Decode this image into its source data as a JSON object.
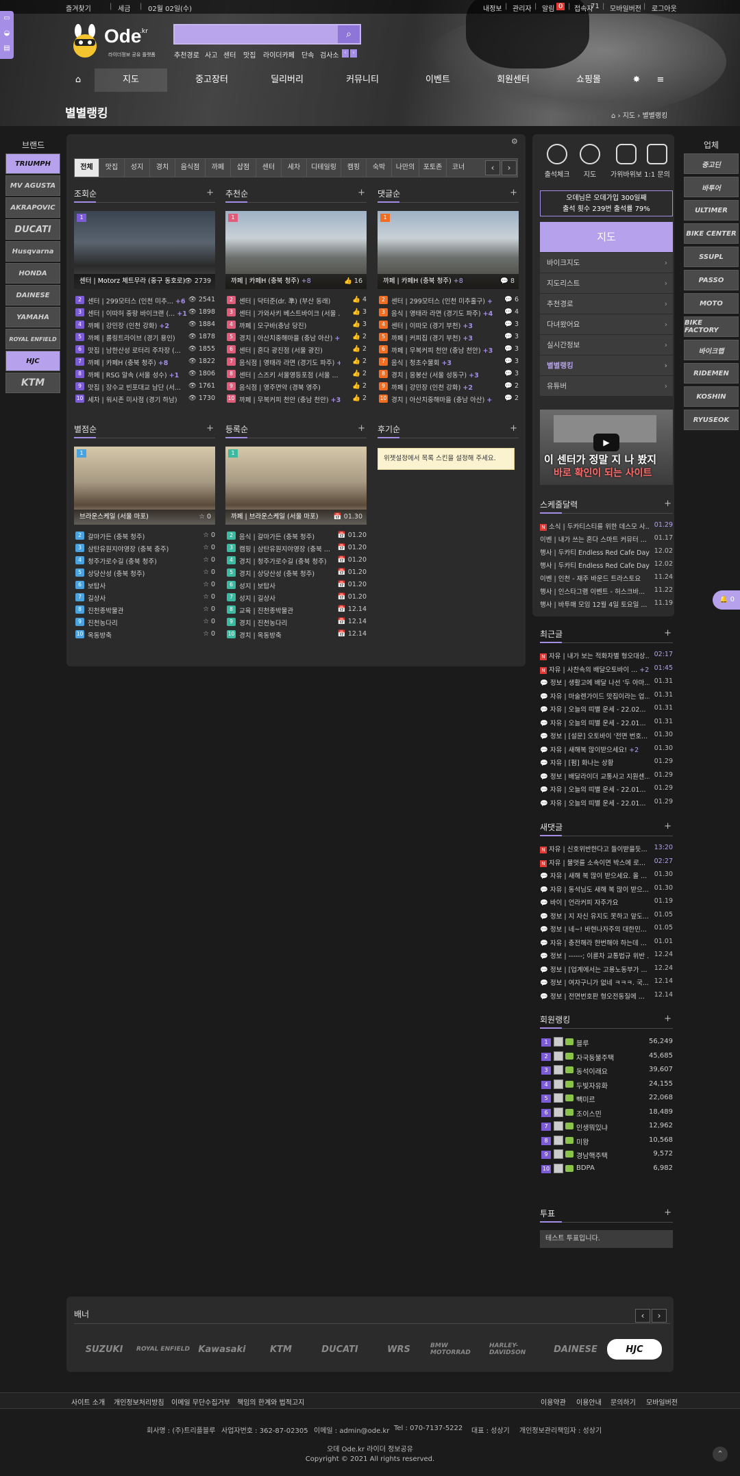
{
  "topbar": {
    "left": [
      "즐겨찾기",
      "세금",
      "02월 02일(수)"
    ],
    "right": [
      "내정보",
      "관리자",
      "알림",
      "접속자",
      "모바일버전",
      "로그아웃"
    ],
    "alarm_count": "0",
    "visitor_count": "71"
  },
  "logo": {
    "text": "Ode",
    "sup": ".kr",
    "tagline": "라이더정보 공유 플랫폼"
  },
  "search": {
    "placeholder": ""
  },
  "keywords": [
    "추천경로",
    "사고",
    "센터",
    "맛집",
    "라이더카페",
    "단속",
    "검사소"
  ],
  "nav": [
    "지도",
    "중고장터",
    "딜리버리",
    "커뮤니티",
    "이벤트",
    "회원센터",
    "쇼핑몰"
  ],
  "page_title": "별별랭킹",
  "breadcrumb": [
    "지도",
    "별별랭킹"
  ],
  "brand_left": {
    "title": "브랜드",
    "items": [
      "TRIUMPH",
      "MV AGUSTA",
      "AKRAPOVIC",
      "DUCATI",
      "Husqvarna",
      "HONDA",
      "DAINESE",
      "YAMAHA",
      "ROYAL ENFIELD",
      "HJC",
      "KTM"
    ]
  },
  "brand_right": {
    "title": "업체",
    "items": [
      "중고딘",
      "바투어",
      "ULTIMER",
      "BIKE CENTER",
      "SSUPL",
      "PASSO",
      "MOTO",
      "BIKE FACTORY",
      "바이크랩",
      "RIDEMEN",
      "KOSHIN",
      "RYUSEOK"
    ]
  },
  "tabs": {
    "items": [
      "전체",
      "맛집",
      "성지",
      "경치",
      "음식점",
      "까페",
      "샵점",
      "센터",
      "세차",
      "디테일링",
      "캠핑",
      "숙박",
      "나만의",
      "포토존",
      "코너"
    ],
    "prev": "‹",
    "next": "›"
  },
  "sections": [
    {
      "title": "조회순",
      "feature": {
        "rank": "1",
        "caption": "센터 | Motorz 체트무라 (중구 동호로)",
        "count": "2739",
        "count_icon": "👁"
      },
      "rows": [
        {
          "n": "2",
          "title": "센터 | 299모터스 (인천 미추...",
          "c": "+6",
          "v": "2541"
        },
        {
          "n": "3",
          "title": "센터 | 이따허 중랑 바이크랜 (...",
          "c": "+1",
          "v": "1898"
        },
        {
          "n": "4",
          "title": "까페 | 강민장 (인천 강화)",
          "c": "+2",
          "v": "1884"
        },
        {
          "n": "5",
          "title": "까페 | 롤링트라이브 (경기 용인)",
          "c": "",
          "v": "1878"
        },
        {
          "n": "6",
          "title": "맛집 | 남한산성 로터리 주차장 (...",
          "c": "",
          "v": "1855"
        },
        {
          "n": "7",
          "title": "까페 | 카페H (충북 청주)",
          "c": "+8",
          "v": "1822"
        },
        {
          "n": "8",
          "title": "까페 | RSG 알속 (서울 성수)",
          "c": "+1",
          "v": "1806"
        },
        {
          "n": "9",
          "title": "맛집 | 장수교 빈포대교 남단 (서...",
          "c": "",
          "v": "1761"
        },
        {
          "n": "10",
          "title": "세차 | 워시존 미사점 (경기 하남)",
          "c": "",
          "v": "1730"
        }
      ]
    },
    {
      "title": "추천순",
      "feature": {
        "rank": "1",
        "caption": "까페 | 카페H (충북 청주)",
        "c": "+8",
        "count": "16",
        "count_icon": "👍"
      },
      "rows": [
        {
          "n": "2",
          "title": "센터 | 닥터준(dr. 準) (부산 동래)",
          "c": "",
          "v": "4"
        },
        {
          "n": "3",
          "title": "센터 | 가와사키 베스트바이크 (서울 ...",
          "c": "",
          "v": "3"
        },
        {
          "n": "4",
          "title": "까페 | 모구바(충남 당진)",
          "c": "",
          "v": "3"
        },
        {
          "n": "5",
          "title": "경치 | 아산치중해마을 (충남 아산)",
          "c": "+2",
          "v": "2"
        },
        {
          "n": "6",
          "title": "센터 | 혼다 광진점 (서울 광진)",
          "c": "",
          "v": "2"
        },
        {
          "n": "7",
          "title": "음식점 | 영태라 라면 (경기도 파주)",
          "c": "+4",
          "v": "2"
        },
        {
          "n": "8",
          "title": "센터 | 스즈키 서울영등포점 (서울 ...",
          "c": "+2",
          "v": "2"
        },
        {
          "n": "9",
          "title": "음식점 | 영주면악 (경북 영주)",
          "c": "",
          "v": "2"
        },
        {
          "n": "10",
          "title": "까페 | 무복커피 천안 (충남 천안)",
          "c": "+3",
          "v": "2"
        }
      ]
    },
    {
      "title": "댓글순",
      "feature": {
        "rank": "1",
        "caption": "까페 | 카페H (충북 청주)",
        "c": "+8",
        "count": "8",
        "count_icon": "💬"
      },
      "rows": [
        {
          "n": "2",
          "title": "센터 | 299모터스 (인천 미추홀구)",
          "c": "+6",
          "v": "6"
        },
        {
          "n": "3",
          "title": "음식 | 영태라 라면 (경기도 파주)",
          "c": "+4",
          "v": "4"
        },
        {
          "n": "4",
          "title": "센터 | 이따모 (경기 부천)",
          "c": "+3",
          "v": "3"
        },
        {
          "n": "5",
          "title": "까페 | 커피집 (경기 부천)",
          "c": "+3",
          "v": "3"
        },
        {
          "n": "6",
          "title": "까페 | 무복커피 천안 (충남 천안)",
          "c": "+3",
          "v": "3"
        },
        {
          "n": "7",
          "title": "음식 | 청초수물회",
          "c": "+3",
          "v": "3"
        },
        {
          "n": "8",
          "title": "경치 | 응봉산 (서울 성동구)",
          "c": "+3",
          "v": "3"
        },
        {
          "n": "9",
          "title": "까페 | 강민장 (인천 강화)",
          "c": "+2",
          "v": "2"
        },
        {
          "n": "10",
          "title": "경치 | 아산치중해마을 (충남 아산)",
          "c": "+2",
          "v": "2"
        }
      ]
    },
    {
      "title": "별점순",
      "feature": {
        "rank": "1",
        "caption": "브라운스케일 (서울 마포)",
        "count": "0",
        "count_icon": "☆"
      },
      "rows": [
        {
          "n": "2",
          "title": "갈마가든 (충북 청주)",
          "c": "",
          "v": "0"
        },
        {
          "n": "3",
          "title": "삼탄유원지야영장 (충북 충주)",
          "c": "",
          "v": "0"
        },
        {
          "n": "4",
          "title": "청주가로수길 (충북 청주)",
          "c": "",
          "v": "0"
        },
        {
          "n": "5",
          "title": "상당산성 (충북 청주)",
          "c": "",
          "v": "0"
        },
        {
          "n": "6",
          "title": "보탑사",
          "c": "",
          "v": "0"
        },
        {
          "n": "7",
          "title": "길상사",
          "c": "",
          "v": "0"
        },
        {
          "n": "8",
          "title": "진천종박물관",
          "c": "",
          "v": "0"
        },
        {
          "n": "9",
          "title": "진천농다리",
          "c": "",
          "v": "0"
        },
        {
          "n": "10",
          "title": "옥동방축",
          "c": "",
          "v": "0"
        }
      ]
    },
    {
      "title": "등록순",
      "feature": {
        "rank": "1",
        "caption": "까페 | 브라운스케일 (서울 마포)",
        "count": "01.30",
        "count_icon": "📅"
      },
      "rows": [
        {
          "n": "2",
          "title": "음식 | 갈마가든 (충북 청주)",
          "c": "",
          "v": "01.20"
        },
        {
          "n": "3",
          "title": "캠핑 | 삼탄유원지야영장 (충북 ...",
          "c": "",
          "v": "01.20"
        },
        {
          "n": "4",
          "title": "경치 | 청주가로수길 (충북 청주)",
          "c": "",
          "v": "01.20"
        },
        {
          "n": "5",
          "title": "경치 | 상당산성 (충북 청주)",
          "c": "",
          "v": "01.20"
        },
        {
          "n": "6",
          "title": "성지 | 보탑사",
          "c": "",
          "v": "01.20"
        },
        {
          "n": "7",
          "title": "성지 | 길상사",
          "c": "",
          "v": "01.20"
        },
        {
          "n": "8",
          "title": "교육 | 진천종박물관",
          "c": "",
          "v": "12.14"
        },
        {
          "n": "9",
          "title": "경치 | 진천농다리",
          "c": "",
          "v": "12.14"
        },
        {
          "n": "10",
          "title": "경치 | 옥동방축",
          "c": "",
          "v": "12.14"
        }
      ]
    },
    {
      "title": "후기순",
      "notice": "위젯설정에서 목록 스킨을 설정해 주세요."
    }
  ],
  "quick": [
    "출석체크",
    "지도",
    "가위바위보",
    "1:1 문의"
  ],
  "attendance": {
    "line1": "오데님은 오데가입 300일째",
    "line2": "출석 횟수 239번 출석률 79%"
  },
  "right_menu": {
    "title": "지도",
    "items": [
      "바이크지도",
      "지도리스트",
      "추천경로",
      "다녀왔어요",
      "실시간정보",
      "별별랭킹",
      "유튜버"
    ]
  },
  "video": {
    "line1": "이 센터가 정말 지 나 봤지",
    "line2": "바로 확인이 되는 사이트"
  },
  "schedule": {
    "title": "스케줄달력",
    "items": [
      {
        "t": "소식 | 두카티스티를 위한 데스모 사...",
        "d": "01.29",
        "new": true
      },
      {
        "t": "이벤 | 내가 쓰는 혼다 스마트 커뮤터 ...",
        "d": "01.17"
      },
      {
        "t": "행사 | 두카티 Endless Red Cafe Day",
        "d": "12.02"
      },
      {
        "t": "행사 | 두카티 Endless Red Cafe Day",
        "d": "12.02"
      },
      {
        "t": "이벤 | 인천 - 재주 바운드 트라스토요",
        "d": "11.24"
      },
      {
        "t": "행사 | 인스타그램 이벤트 - 허스크바...",
        "d": "11.22"
      },
      {
        "t": "행사 | 바투매 모임 12월 4일 토요일 ...",
        "d": "11.19"
      }
    ]
  },
  "recent_posts": {
    "title": "최근글",
    "items": [
      {
        "t": "자유 | 내가 보는 적화차별 형오대상...",
        "d": "02:17",
        "new": true
      },
      {
        "t": "자유 | 사찬속의 배달오토바이 ...",
        "c": "+2",
        "d": "01:45",
        "new": true
      },
      {
        "t": "정보 | 생활고에 배달 나선 '두 아마...",
        "d": "01.31"
      },
      {
        "t": "자유 | 마술렌가이드 맛집이라는 업...",
        "d": "01.31"
      },
      {
        "t": "자유 | 오늘의 띠별 운세 - 22.02...",
        "d": "01.31"
      },
      {
        "t": "자유 | 오늘의 띠별 운세 - 22.01...",
        "d": "01.31"
      },
      {
        "t": "정보 | [설문] 오토바이 '전면 번호...",
        "d": "01.30"
      },
      {
        "t": "자유 | 새해복 많이받으세요!",
        "c": "+2",
        "d": "01.30"
      },
      {
        "t": "자유 | [펌] 화나는 상황",
        "d": "01.29"
      },
      {
        "t": "정보 | 배달라이더 교통사고 지원센...",
        "d": "01.29"
      },
      {
        "t": "자유 | 오늘의 띠별 운세 - 22.01...",
        "d": "01.29"
      },
      {
        "t": "자유 | 오늘의 띠별 운세 - 22.01...",
        "d": "01.29"
      }
    ]
  },
  "recent_comments": {
    "title": "새댓글",
    "items": [
      {
        "t": "자유 | 신호위반한다고 들이받을듯...",
        "d": "13:20",
        "new": true
      },
      {
        "t": "자유 | 물멋를 소속이면 박스에 로...",
        "d": "02:27",
        "new": true
      },
      {
        "t": "자유 | 새해 복 많이 받으세요. 올 ...",
        "d": "01.30"
      },
      {
        "t": "자유 | 동석님도 새해 복 많이 받으...",
        "d": "01.30"
      },
      {
        "t": "바이 | 언라커피 자주가요",
        "d": "01.19"
      },
      {
        "t": "정보 | 지 자신 유지도 못하고 앞도...",
        "d": "01.05"
      },
      {
        "t": "정보 | 네~! 바현나자주의 대한민...",
        "d": "01.05"
      },
      {
        "t": "자유 | 충전해라 한번해야 하는데 ...",
        "d": "01.01"
      },
      {
        "t": "정보 | ------; 이륜차 교통법규 위반 ...",
        "d": "12.24"
      },
      {
        "t": "정보 | [업계에서는 고용노동부가 ...",
        "d": "12.24"
      },
      {
        "t": "정보 | 여자구니가 없네 ㅋㅋㅋ. 국...",
        "d": "12.14"
      },
      {
        "t": "정보 | 전면번호판 형오전동질에 ...",
        "d": "12.14"
      }
    ]
  },
  "member_rank": {
    "title": "회원랭킹",
    "items": [
      {
        "n": "1",
        "name": "블루",
        "score": "56,249"
      },
      {
        "n": "2",
        "name": "자국동불주택",
        "score": "45,685"
      },
      {
        "n": "3",
        "name": "동석이래요",
        "score": "39,607"
      },
      {
        "n": "4",
        "name": "두빛자유화",
        "score": "24,155"
      },
      {
        "n": "5",
        "name": "빽미르",
        "score": "22,068"
      },
      {
        "n": "6",
        "name": "조이스민",
        "score": "18,489"
      },
      {
        "n": "7",
        "name": "인생뭐있냐",
        "score": "12,962"
      },
      {
        "n": "8",
        "name": "미왕",
        "score": "10,568"
      },
      {
        "n": "9",
        "name": "경남핵주택",
        "score": "9,572"
      },
      {
        "n": "10",
        "name": "BDPA",
        "score": "6,982"
      }
    ]
  },
  "poll": {
    "title": "투표",
    "text": "테스트 투표입니다."
  },
  "banner": {
    "title": "배너",
    "items": [
      "SUZUKI",
      "ROYAL ENFIELD",
      "Kawasaki",
      "KTM",
      "DUCATI",
      "WRS",
      "BMW MOTORRAD",
      "HARLEY-DAVIDSON",
      "DAINESE",
      "HJC"
    ]
  },
  "footer": {
    "left_links": [
      "사이트 소개",
      "개인정보처리방침",
      "이메일 무단수집거부",
      "책임의 한계와 법적고지"
    ],
    "right_links": [
      "이용약관",
      "이용안내",
      "문의하기",
      "모바일버전"
    ],
    "info": [
      "회사명 : (주)트리플블루",
      "사업자번호 : 362-87-02305",
      "이메일 : admin@ode.kr",
      "Tel : 070-7137-5222",
      "대표 : 성상기",
      "개인정보관리책임자 : 성상기"
    ],
    "tagline": "오데 Ode.kr 라이더 정보공유",
    "copyright": "Copyright © 2021 All rights reserved."
  },
  "colors": {
    "accent": "#a48ee6",
    "accent_light": "#b6a2ec",
    "bg": "#1b1b1b",
    "panel": "#2b2b2b"
  }
}
